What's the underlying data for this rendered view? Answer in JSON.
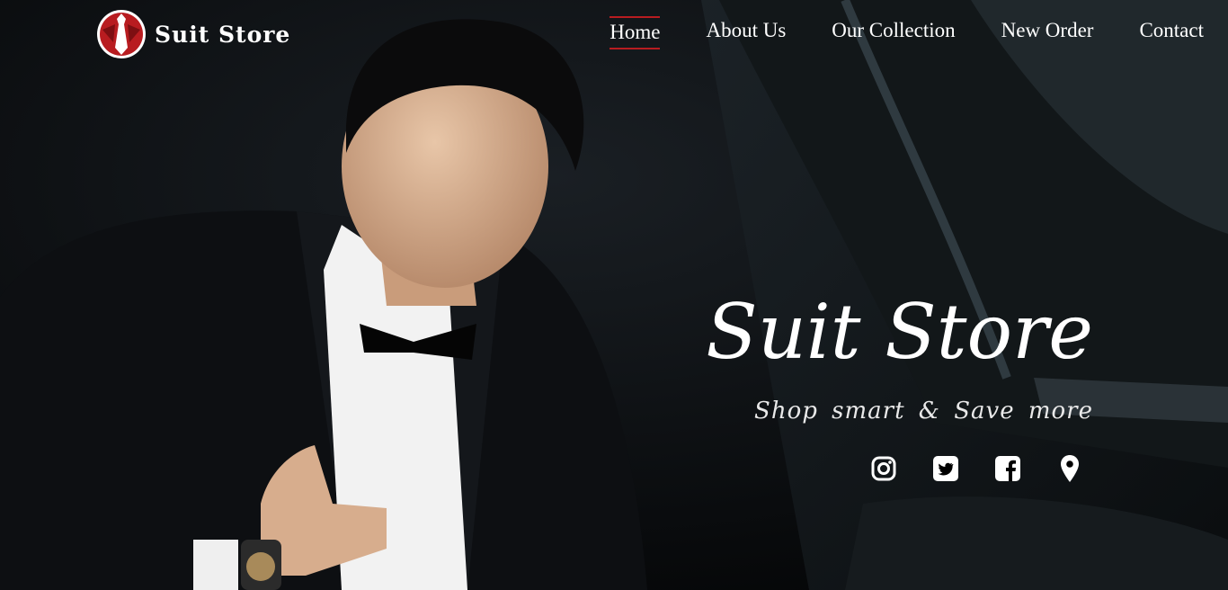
{
  "brand": {
    "name": "Suit Store",
    "logo_icon": "tie-logo-icon",
    "accent_color": "#b81c20"
  },
  "nav": {
    "items": [
      {
        "label": "Home",
        "active": true
      },
      {
        "label": "About Us",
        "active": false
      },
      {
        "label": "Our Collection",
        "active": false
      },
      {
        "label": "New Order",
        "active": false
      },
      {
        "label": "Contact",
        "active": false
      }
    ]
  },
  "hero": {
    "title": "Suit Store",
    "subtitle": "Shop smart & Save more",
    "image": "man in black tuxedo and bow tie stepping out of a car"
  },
  "social": {
    "icons": [
      "instagram-icon",
      "twitter-icon",
      "facebook-icon",
      "map-pin-icon"
    ]
  }
}
